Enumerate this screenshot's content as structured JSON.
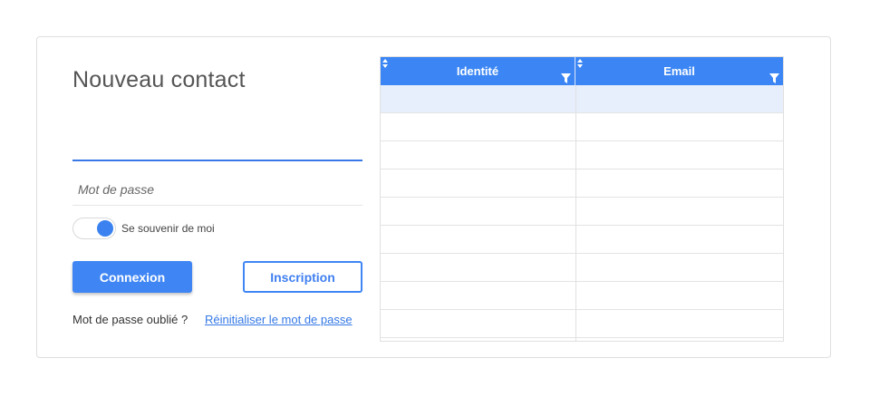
{
  "form": {
    "title": "Nouveau contact",
    "password_placeholder": "Mot de passe",
    "remember_label": "Se souvenir de moi",
    "remember_on": true,
    "login_label": "Connexion",
    "register_label": "Inscription",
    "forgot_label": "Mot de passe oublié ?",
    "reset_link": "Réinitialiser le mot de passe"
  },
  "grid": {
    "columns": [
      "Identité",
      "Email"
    ],
    "rows": [
      {
        "identite": "",
        "email": "",
        "selected": true
      },
      {
        "identite": "",
        "email": ""
      },
      {
        "identite": "",
        "email": ""
      },
      {
        "identite": "",
        "email": ""
      },
      {
        "identite": "",
        "email": ""
      },
      {
        "identite": "",
        "email": ""
      },
      {
        "identite": "",
        "email": ""
      },
      {
        "identite": "",
        "email": ""
      },
      {
        "identite": "",
        "email": ""
      }
    ]
  },
  "colors": {
    "accent": "#3b86f4",
    "selected_row": "#e8effc",
    "link": "#3478e5"
  }
}
